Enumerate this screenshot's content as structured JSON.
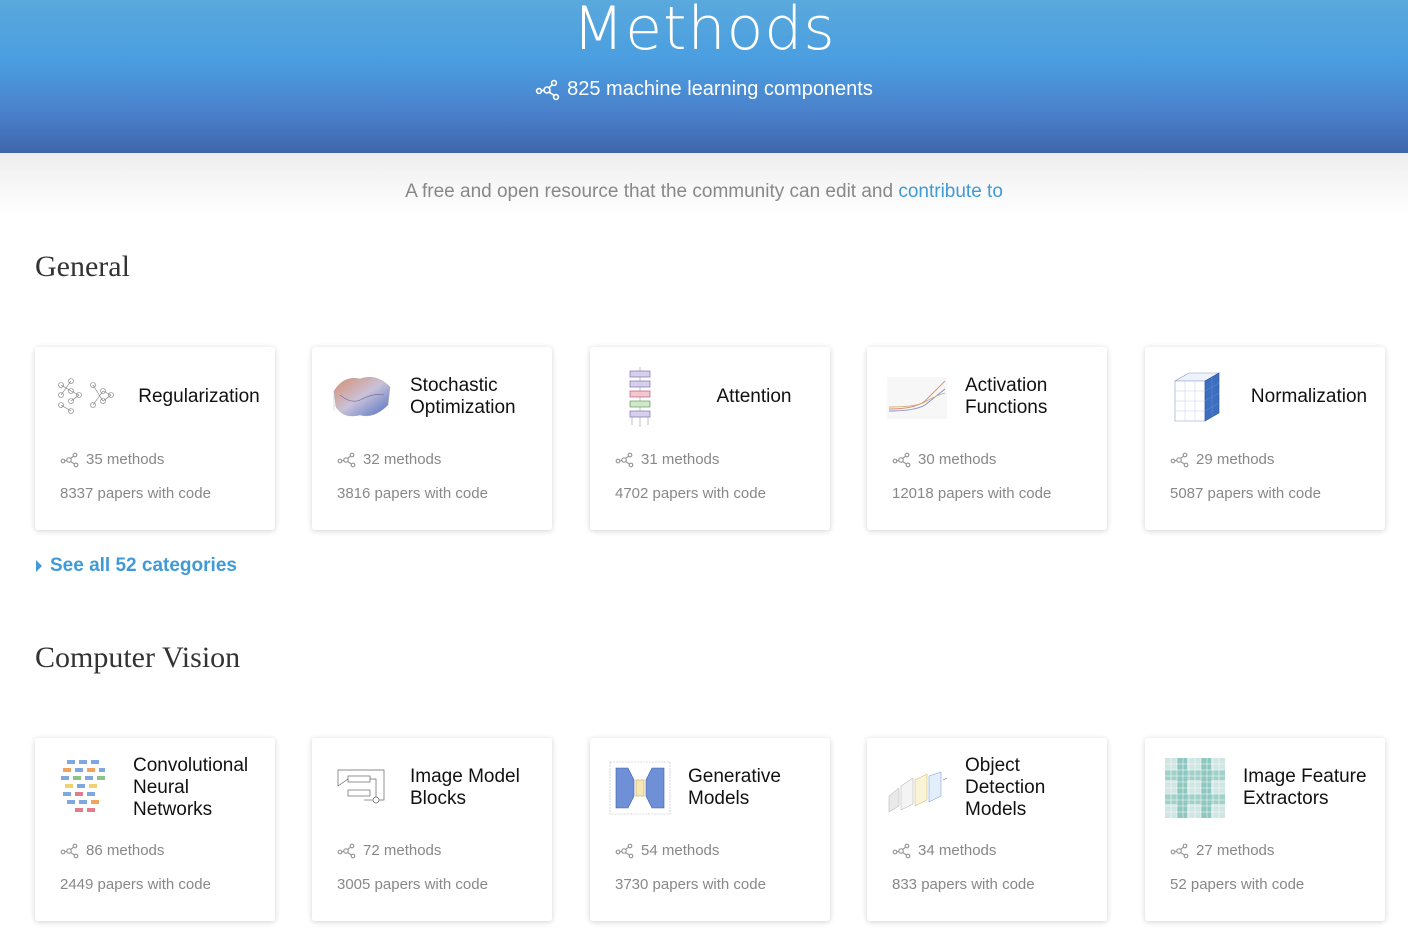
{
  "hero": {
    "title": "Methods",
    "subtitle": "825 machine learning components"
  },
  "tagline": {
    "text": "A free and open resource that the community can edit and ",
    "link": "contribute to"
  },
  "sections": [
    {
      "title": "General",
      "see_all": "See all 52 categories",
      "cards": [
        {
          "name": "Regularization",
          "methods": "35 methods",
          "papers": "8337 papers with code",
          "icon": "regularization-diagram-icon"
        },
        {
          "name": "Stochastic Optimization",
          "methods": "32 methods",
          "papers": "3816 papers with code",
          "icon": "loss-surface-icon"
        },
        {
          "name": "Attention",
          "methods": "31 methods",
          "papers": "4702 papers with code",
          "icon": "attention-block-icon"
        },
        {
          "name": "Activation Functions",
          "methods": "30 methods",
          "papers": "12018 papers with code",
          "icon": "activation-curve-icon"
        },
        {
          "name": "Normalization",
          "methods": "29 methods",
          "papers": "5087 papers with code",
          "icon": "normalization-cube-icon"
        }
      ]
    },
    {
      "title": "Computer Vision",
      "cards": [
        {
          "name": "Convolutional Neural Networks",
          "methods": "86 methods",
          "papers": "2449 papers with code",
          "icon": "cnn-architecture-icon"
        },
        {
          "name": "Image Model Blocks",
          "methods": "72 methods",
          "papers": "3005 papers with code",
          "icon": "residual-block-icon"
        },
        {
          "name": "Generative Models",
          "methods": "54 methods",
          "papers": "3730 papers with code",
          "icon": "encoder-decoder-icon"
        },
        {
          "name": "Object Detection Models",
          "methods": "34 methods",
          "papers": "833 papers with code",
          "icon": "detection-pipeline-icon"
        },
        {
          "name": "Image Feature Extractors",
          "methods": "27 methods",
          "papers": "52 papers with code",
          "icon": "feature-grid-icon"
        }
      ]
    }
  ],
  "colors": {
    "accent": "#3f9ad6",
    "hero_top": "#5aa9dd",
    "hero_bottom": "#3f66ad",
    "muted_text": "#888888"
  }
}
